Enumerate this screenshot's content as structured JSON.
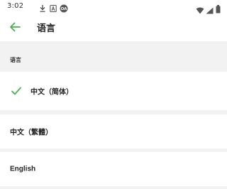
{
  "status_bar": {
    "time": "3:02",
    "left_icons": [
      "download-icon",
      "a-box-icon",
      "tethering-icon"
    ],
    "right_icons": [
      "wifi-icon",
      "signal-icon",
      "battery-icon"
    ]
  },
  "app_bar": {
    "back_icon": "arrow-left-icon",
    "title": "语言"
  },
  "section": {
    "title": "语言"
  },
  "languages": [
    {
      "label": "中文（简体）",
      "selected": true
    },
    {
      "label": "中文（繁體）",
      "selected": false
    },
    {
      "label": "English",
      "selected": false
    }
  ],
  "colors": {
    "accent": "#4caf50",
    "background": "#f2f2f2",
    "card": "#ffffff",
    "text": "#222222"
  }
}
